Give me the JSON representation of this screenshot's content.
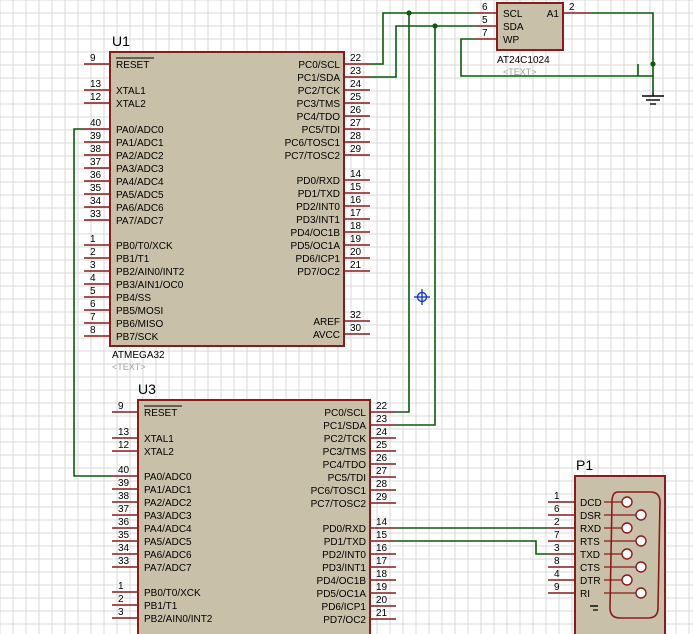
{
  "u1": {
    "ref": "U1",
    "value": "ATMEGA32",
    "text_placeholder": "<TEXT>",
    "left_pins": [
      {
        "num": "9",
        "name": "RESET"
      },
      {
        "num": "13",
        "name": "XTAL1"
      },
      {
        "num": "12",
        "name": "XTAL2"
      },
      {
        "num": "40",
        "name": "PA0/ADC0"
      },
      {
        "num": "39",
        "name": "PA1/ADC1"
      },
      {
        "num": "38",
        "name": "PA2/ADC2"
      },
      {
        "num": "37",
        "name": "PA3/ADC3"
      },
      {
        "num": "36",
        "name": "PA4/ADC4"
      },
      {
        "num": "35",
        "name": "PA5/ADC5"
      },
      {
        "num": "34",
        "name": "PA6/ADC6"
      },
      {
        "num": "33",
        "name": "PA7/ADC7"
      },
      {
        "num": "1",
        "name": "PB0/T0/XCK"
      },
      {
        "num": "2",
        "name": "PB1/T1"
      },
      {
        "num": "3",
        "name": "PB2/AIN0/INT2"
      },
      {
        "num": "4",
        "name": "PB3/AIN1/OC0"
      },
      {
        "num": "5",
        "name": "PB4/SS"
      },
      {
        "num": "6",
        "name": "PB5/MOSI"
      },
      {
        "num": "7",
        "name": "PB6/MISO"
      },
      {
        "num": "8",
        "name": "PB7/SCK"
      }
    ],
    "right_pins": [
      {
        "num": "22",
        "name": "PC0/SCL"
      },
      {
        "num": "23",
        "name": "PC1/SDA"
      },
      {
        "num": "24",
        "name": "PC2/TCK"
      },
      {
        "num": "25",
        "name": "PC3/TMS"
      },
      {
        "num": "26",
        "name": "PC4/TDO"
      },
      {
        "num": "27",
        "name": "PC5/TDI"
      },
      {
        "num": "28",
        "name": "PC6/TOSC1"
      },
      {
        "num": "29",
        "name": "PC7/TOSC2"
      },
      {
        "num": "14",
        "name": "PD0/RXD"
      },
      {
        "num": "15",
        "name": "PD1/TXD"
      },
      {
        "num": "16",
        "name": "PD2/INT0"
      },
      {
        "num": "17",
        "name": "PD3/INT1"
      },
      {
        "num": "18",
        "name": "PD4/OC1B"
      },
      {
        "num": "19",
        "name": "PD5/OC1A"
      },
      {
        "num": "20",
        "name": "PD6/ICP1"
      },
      {
        "num": "21",
        "name": "PD7/OC2"
      },
      {
        "num": "32",
        "name": "AREF"
      },
      {
        "num": "30",
        "name": "AVCC"
      }
    ]
  },
  "u3": {
    "ref": "U3",
    "left_pins": [
      {
        "num": "9",
        "name": "RESET"
      },
      {
        "num": "13",
        "name": "XTAL1"
      },
      {
        "num": "12",
        "name": "XTAL2"
      },
      {
        "num": "40",
        "name": "PA0/ADC0"
      },
      {
        "num": "39",
        "name": "PA1/ADC1"
      },
      {
        "num": "38",
        "name": "PA2/ADC2"
      },
      {
        "num": "37",
        "name": "PA3/ADC3"
      },
      {
        "num": "36",
        "name": "PA4/ADC4"
      },
      {
        "num": "35",
        "name": "PA5/ADC5"
      },
      {
        "num": "34",
        "name": "PA6/ADC6"
      },
      {
        "num": "33",
        "name": "PA7/ADC7"
      },
      {
        "num": "1",
        "name": "PB0/T0/XCK"
      },
      {
        "num": "2",
        "name": "PB1/T1"
      },
      {
        "num": "3",
        "name": "PB2/AIN0/INT2"
      }
    ],
    "right_pins": [
      {
        "num": "22",
        "name": "PC0/SCL"
      },
      {
        "num": "23",
        "name": "PC1/SDA"
      },
      {
        "num": "24",
        "name": "PC2/TCK"
      },
      {
        "num": "25",
        "name": "PC3/TMS"
      },
      {
        "num": "26",
        "name": "PC4/TDO"
      },
      {
        "num": "27",
        "name": "PC5/TDI"
      },
      {
        "num": "28",
        "name": "PC6/TOSC1"
      },
      {
        "num": "29",
        "name": "PC7/TOSC2"
      },
      {
        "num": "14",
        "name": "PD0/RXD"
      },
      {
        "num": "15",
        "name": "PD1/TXD"
      },
      {
        "num": "16",
        "name": "PD2/INT0"
      },
      {
        "num": "17",
        "name": "PD3/INT1"
      },
      {
        "num": "18",
        "name": "PD4/OC1B"
      },
      {
        "num": "19",
        "name": "PD5/OC1A"
      },
      {
        "num": "20",
        "name": "PD6/ICP1"
      },
      {
        "num": "21",
        "name": "PD7/OC2"
      }
    ]
  },
  "eeprom": {
    "value": "AT24C1024",
    "text_placeholder": "<TEXT>",
    "left_pins": [
      {
        "num": "6",
        "name": "SCL"
      },
      {
        "num": "5",
        "name": "SDA"
      },
      {
        "num": "7",
        "name": "WP"
      }
    ],
    "right_pins": [
      {
        "num": "2",
        "name": "A1"
      }
    ]
  },
  "p1": {
    "ref": "P1",
    "pins": [
      {
        "num": "1",
        "name": "DCD"
      },
      {
        "num": "6",
        "name": "DSR"
      },
      {
        "num": "2",
        "name": "RXD"
      },
      {
        "num": "7",
        "name": "RTS"
      },
      {
        "num": "3",
        "name": "TXD"
      },
      {
        "num": "8",
        "name": "CTS"
      },
      {
        "num": "4",
        "name": "DTR"
      },
      {
        "num": "9",
        "name": "RI"
      }
    ]
  },
  "colors": {
    "component_body": "#c8c0a8",
    "component_border": "#8b1a1a",
    "wire": "#0a5a0a",
    "probe": "#1a3ad0",
    "grid": "#d9d9d9"
  }
}
